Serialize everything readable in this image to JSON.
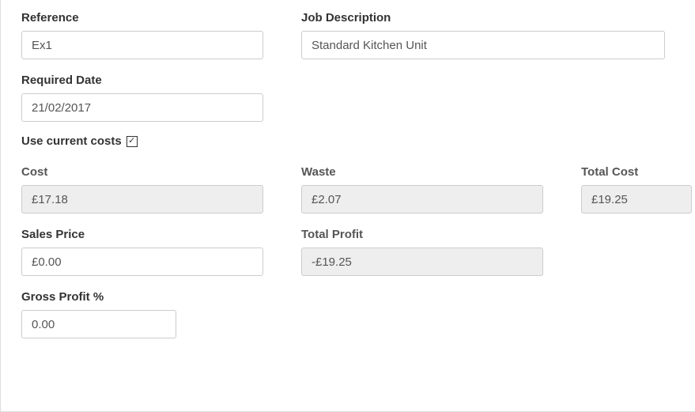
{
  "reference": {
    "label": "Reference",
    "value": "Ex1"
  },
  "job_description": {
    "label": "Job Description",
    "value": "Standard Kitchen Unit"
  },
  "required_date": {
    "label": "Required Date",
    "value": "21/02/2017"
  },
  "use_current_costs": {
    "label": "Use current costs",
    "checked": true,
    "checkmark": "✓"
  },
  "cost": {
    "label": "Cost",
    "value": "£17.18"
  },
  "waste": {
    "label": "Waste",
    "value": "£2.07"
  },
  "total_cost": {
    "label": "Total Cost",
    "value": "£19.25"
  },
  "sales_price": {
    "label": "Sales Price",
    "value": "£0.00"
  },
  "total_profit": {
    "label": "Total Profit",
    "value": "-£19.25"
  },
  "gross_profit_pct": {
    "label": "Gross Profit %",
    "value": "0.00"
  }
}
